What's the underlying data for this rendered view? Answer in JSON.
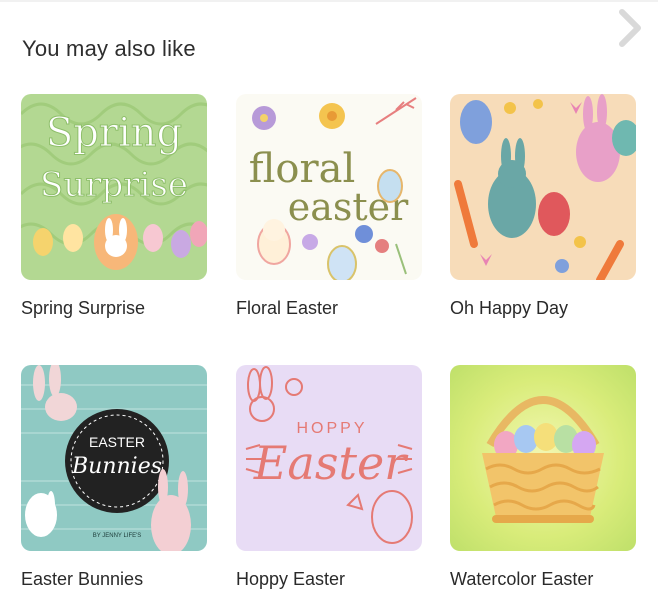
{
  "section": {
    "title": "You may also like"
  },
  "navigation": {
    "next_icon": "chevron-right-icon"
  },
  "cards": [
    {
      "label": "Spring Surprise",
      "art_text": [
        "Spring",
        "Surprise"
      ],
      "accent": "#a9cf86"
    },
    {
      "label": "Floral Easter",
      "art_text": [
        "floral",
        "easter"
      ],
      "accent": "#8b8f4e"
    },
    {
      "label": "Oh Happy Day",
      "accent": "#f6d9b4"
    },
    {
      "label": "Easter Bunnies",
      "art_text": [
        "EASTER",
        "Bunnies",
        "BY JENNY LIFE'S"
      ],
      "accent": "#8fc9c3"
    },
    {
      "label": "Hoppy Easter",
      "art_text": [
        "HOPPY",
        "Easter"
      ],
      "accent": "#e57a74"
    },
    {
      "label": "Watercolor Easter",
      "accent": "#d9ec7a"
    }
  ]
}
